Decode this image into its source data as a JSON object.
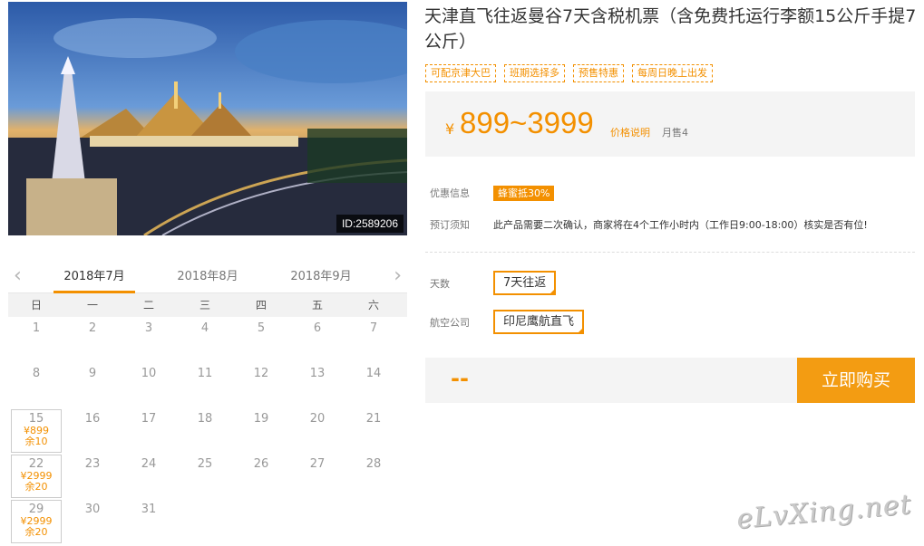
{
  "product": {
    "photo_id": "ID:2589206",
    "title": "天津直飞往返曼谷7天含税机票（含免费托运行李额15公斤手提7公斤）",
    "tags": [
      "可配京津大巴",
      "班期选择多",
      "预售特惠",
      "每周日晚上出发"
    ]
  },
  "price": {
    "currency": "¥",
    "range": "899~3999",
    "note_link": "价格说明",
    "sold": "月售4"
  },
  "info": {
    "promo_label": "优惠信息",
    "promo_badge": "蜂蜜抵30%",
    "notice_label": "预订须知",
    "notice_text": "此产品需要二次确认，商家将在4个工作小时内（工作日9:00-18:00）核实是否有位!"
  },
  "options": {
    "days_label": "天数",
    "days_value": "7天往返",
    "airline_label": "航空公司",
    "airline_value": "印尼鹰航直飞"
  },
  "purchase": {
    "total": "--",
    "buy_label": "立即购买"
  },
  "calendar": {
    "prev_arrow": "‹",
    "next_arrow": "›",
    "months": [
      "2018年7月",
      "2018年8月",
      "2018年9月"
    ],
    "active_month": "2018年7月",
    "weekdays": [
      "日",
      "一",
      "二",
      "三",
      "四",
      "五",
      "六"
    ],
    "leading_blanks": 0,
    "days": [
      {
        "day": "1"
      },
      {
        "day": "2"
      },
      {
        "day": "3"
      },
      {
        "day": "4"
      },
      {
        "day": "5"
      },
      {
        "day": "6"
      },
      {
        "day": "7"
      },
      {
        "day": "8"
      },
      {
        "day": "9"
      },
      {
        "day": "10"
      },
      {
        "day": "11"
      },
      {
        "day": "12"
      },
      {
        "day": "13"
      },
      {
        "day": "14"
      },
      {
        "day": "15",
        "price": "¥899",
        "stock": "余10"
      },
      {
        "day": "16"
      },
      {
        "day": "17"
      },
      {
        "day": "18"
      },
      {
        "day": "19"
      },
      {
        "day": "20"
      },
      {
        "day": "21"
      },
      {
        "day": "22",
        "price": "¥2999",
        "stock": "余20"
      },
      {
        "day": "23"
      },
      {
        "day": "24"
      },
      {
        "day": "25"
      },
      {
        "day": "26"
      },
      {
        "day": "27"
      },
      {
        "day": "28"
      },
      {
        "day": "29",
        "price": "¥2999",
        "stock": "余20"
      },
      {
        "day": "30"
      },
      {
        "day": "31"
      }
    ]
  },
  "watermark": "eLvXing.net",
  "colors": {
    "accent": "#f39000",
    "buy_button": "#f39c12",
    "panel_bg": "#f4f4f4"
  }
}
